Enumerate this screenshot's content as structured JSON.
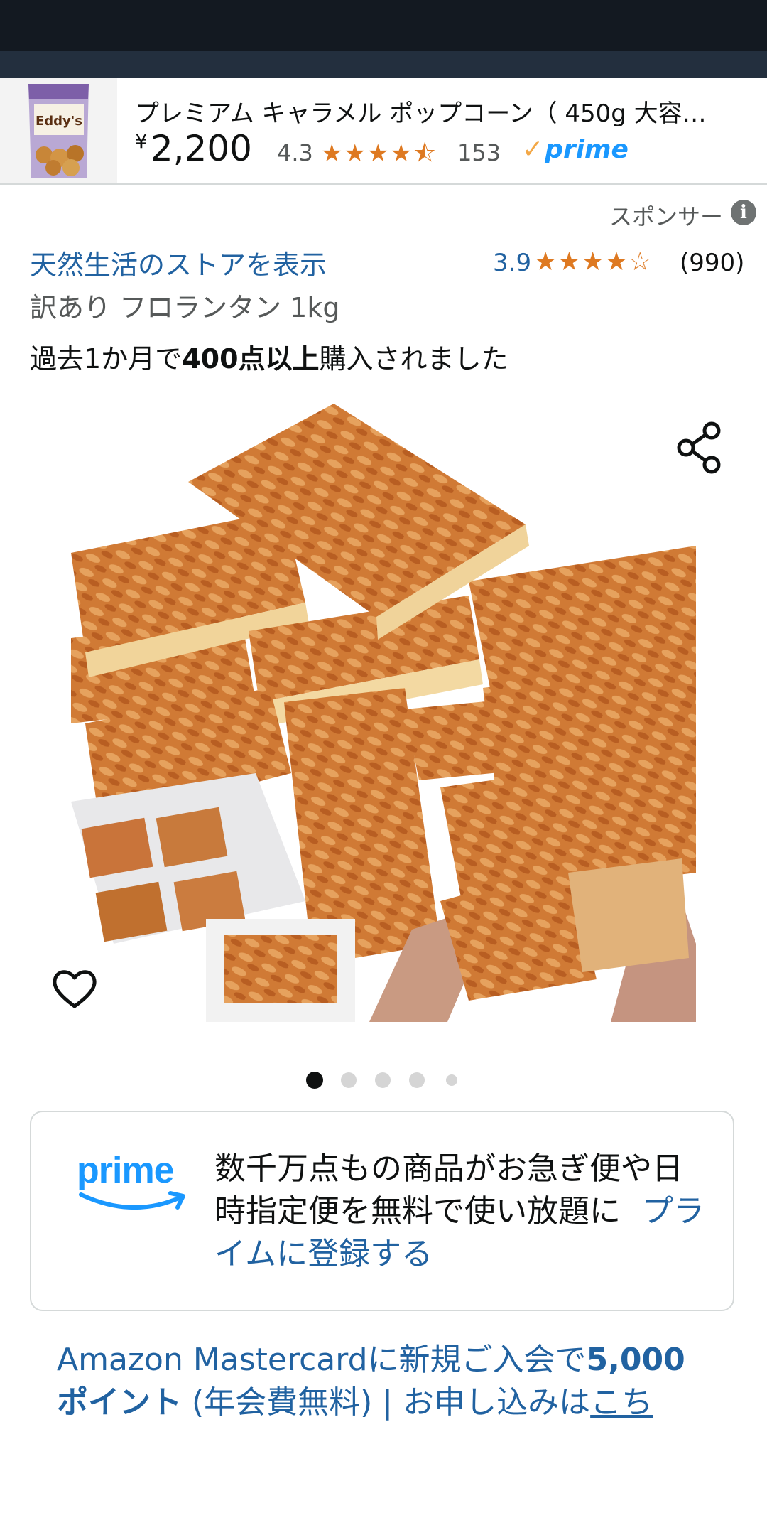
{
  "sponsored_product": {
    "title": "プレミアム キャラメル ポップコーン（ 450g 大容…",
    "price_symbol": "¥",
    "price": "2,200",
    "rating": "4.3",
    "rating_value": 4.5,
    "review_count": "153",
    "prime_label": "prime"
  },
  "sponsor_label": "スポンサー",
  "product": {
    "store_link": "天然生活のストアを表示",
    "rating": "3.9",
    "rating_value": 4,
    "review_count": "(990)",
    "title": "訳あり フロランタン 1kg",
    "purchase_prefix": "過去1か月で",
    "purchase_bold": "400点以上",
    "purchase_suffix": "購入されました"
  },
  "carousel": {
    "total_images": 5,
    "current_index": 0
  },
  "prime_promo": {
    "logo_text": "prime",
    "message": "数千万点もの商品がお急ぎ便や日時指定便を無料で使い放題に",
    "link": "プライムに登録する"
  },
  "mastercard_promo": {
    "line1_prefix": "Amazon Mastercardに新規ご入会で",
    "line1_bold": "5,000",
    "line2_bold": "ポイント",
    "line2_mid": " (年会費無料) | お申し込みは",
    "line2_link": "こち"
  },
  "colors": {
    "status_bar": "#131921",
    "link_blue": "#2162A1",
    "star_orange": "#DE7921",
    "prime_blue": "#1A98FF"
  }
}
